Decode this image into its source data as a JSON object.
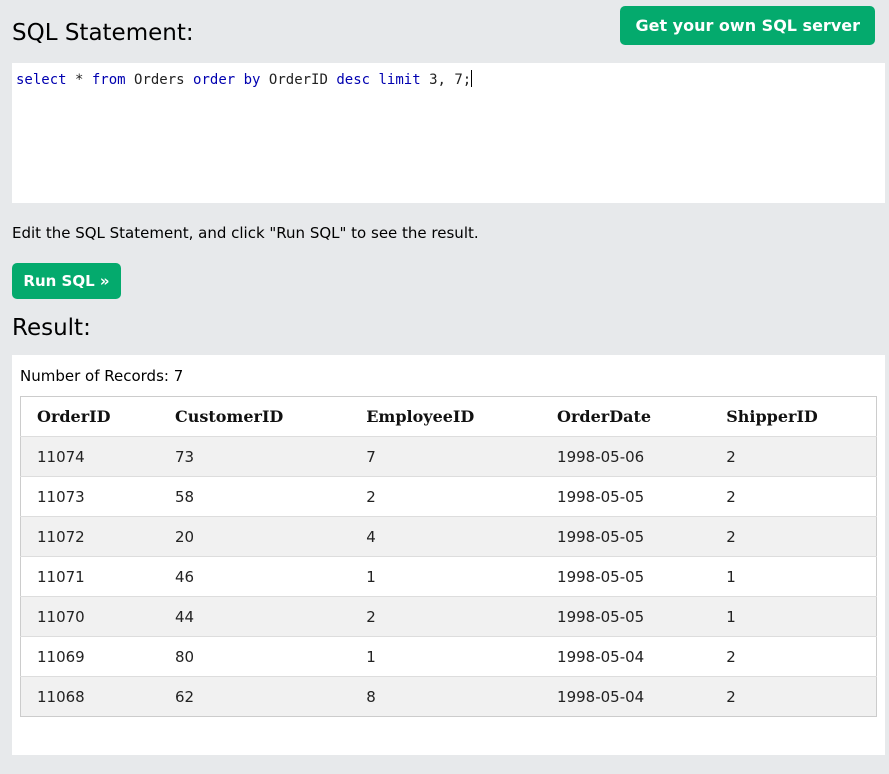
{
  "header": {
    "title": "SQL Statement:",
    "server_button": "Get your own SQL server"
  },
  "editor": {
    "tokens": [
      {
        "t": "select",
        "k": "kw"
      },
      {
        "t": " * ",
        "k": "id"
      },
      {
        "t": "from",
        "k": "kw"
      },
      {
        "t": " Orders ",
        "k": "id"
      },
      {
        "t": "order",
        "k": "kw"
      },
      {
        "t": " ",
        "k": "id"
      },
      {
        "t": "by",
        "k": "kw"
      },
      {
        "t": " OrderID ",
        "k": "id"
      },
      {
        "t": "desc",
        "k": "kw"
      },
      {
        "t": " ",
        "k": "id"
      },
      {
        "t": "limit",
        "k": "kw"
      },
      {
        "t": " 3, 7;",
        "k": "num"
      }
    ]
  },
  "hint": "Edit the SQL Statement, and click \"Run SQL\" to see the result.",
  "run_button": "Run SQL »",
  "result": {
    "title": "Result:",
    "record_count": "Number of Records: 7",
    "columns": [
      "OrderID",
      "CustomerID",
      "EmployeeID",
      "OrderDate",
      "ShipperID"
    ],
    "rows": [
      [
        "11074",
        "73",
        "7",
        "1998-05-06",
        "2"
      ],
      [
        "11073",
        "58",
        "2",
        "1998-05-05",
        "2"
      ],
      [
        "11072",
        "20",
        "4",
        "1998-05-05",
        "2"
      ],
      [
        "11071",
        "46",
        "1",
        "1998-05-05",
        "1"
      ],
      [
        "11070",
        "44",
        "2",
        "1998-05-05",
        "1"
      ],
      [
        "11069",
        "80",
        "1",
        "1998-05-04",
        "2"
      ],
      [
        "11068",
        "62",
        "8",
        "1998-05-04",
        "2"
      ]
    ]
  },
  "colors": {
    "accent": "#04aa6d",
    "background": "#e7e9eb",
    "keyword": "#0000b0"
  }
}
